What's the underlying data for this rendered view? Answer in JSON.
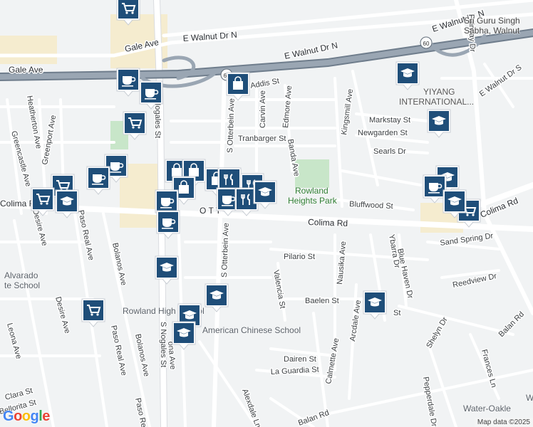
{
  "map": {
    "streets": {
      "e_walnut_dr_n_1": "E Walnut Dr N",
      "e_walnut_dr_n_2": "E Walnut Dr N",
      "e_walnut_dr_n_3": "E Walnut Dr N",
      "gale_ave_1": "Gale Ave",
      "gale_ave_2": "Gale Ave",
      "addis_st": "Addis St",
      "carvin_ave": "Carvin Ave",
      "edmore_ave": "Edmore Ave",
      "kingsmill_ave": "Kingsmill Ave",
      "markstay_st": "Markstay St",
      "newgarden_st": "Newgarden St",
      "searls_dr": "Searls Dr",
      "tranbarger_st": "Tranbarger St",
      "banda_ave": "Banda Ave",
      "s_otterbein_ave_1": "S Otterbein Ave",
      "s_otterbein_ave_2": "S Otterbein Ave",
      "s_nogales_st_1": "S Nogales St",
      "s_nogales_st_2": "S Nogales St",
      "colima_rd_1": "Colima Rd",
      "colima_rd_2": "Colima Rd",
      "colima_rd_left": "Colima R",
      "otterbein_partial": "O T T",
      "bluffwood_st": "Bluffwood St",
      "fairway_dr": "Fairway Dr",
      "e_walnut_dr_s": "E Walnut Dr S",
      "heatherton_ave": "Heatherton Ave",
      "greencastle_ave": "Greencastle Ave",
      "greenport_ave": "Greenport Ave",
      "desire_ave_1": "Desire Ave",
      "desire_ave_2": "Desire Ave",
      "paso_real_ave_1": "Paso Real Ave",
      "paso_real_ave_2": "Paso Real Ave",
      "paso_re": "Paso Re",
      "bolanos_ave_1": "Bolanos Ave",
      "bolanos_ave_2": "Bolanos Ave",
      "pilario_st": "Pilario St",
      "nausika_ave": "Nausika Ave",
      "ybarra_dr": "Ybarra Dr",
      "blue_haven_dr": "Blue Haven Dr",
      "sand_spring_dr": "Sand Spring Dr",
      "reedview_dr": "Reedview Dr",
      "valencia_st": "Valencia St",
      "baelen_st": "Baelen St",
      "arcdale_ave": "Arcdale Ave",
      "st_partial": "St",
      "shelyn_dr": "Shelyn Dr",
      "balan_rd_1": "Balan Rd",
      "balan_rd_2": "Balan Rd",
      "frances_ln": "Frances Ln",
      "dairen_st": "Dairen St",
      "la_guardia_st": "La Guardia St",
      "calmette_ave": "Calmette Ave",
      "pepperdale_dr": "Pepperdale Dr",
      "alexdale_ln": "Alexdale Ln",
      "leona_ave": "Leona Ave",
      "clara_st": "Clara St",
      "bellorita_st": "Bellorita St",
      "ona_ave": "ona Ave",
      "route_60_1": "60",
      "route_60_2": "60"
    },
    "places": {
      "sri_guru_line1": "Sri Guru Singh",
      "sri_guru_line2": "Sabha, Walnut",
      "yiyang": "YIYANG",
      "international": "INTERNATIONAL...",
      "park_line1": "Rowland",
      "park_line2": "Heights Park",
      "rowland_high": "Rowland High School",
      "american_chinese": "American Chinese School",
      "alvarado_line1": "Alvarado",
      "alvarado_line2": "te School",
      "water_oakle": "Water-Oakle",
      "w_partial": "W"
    },
    "markers": [
      {
        "kind": "shopping-cart"
      },
      {
        "kind": "shopping-bag"
      },
      {
        "kind": "school"
      },
      {
        "kind": "school"
      },
      {
        "kind": "cafe"
      },
      {
        "kind": "cafe"
      },
      {
        "kind": "shopping-cart"
      },
      {
        "kind": "cafe"
      },
      {
        "kind": "cafe"
      },
      {
        "kind": "shopping-cart"
      },
      {
        "kind": "shopping-cart"
      },
      {
        "kind": "school"
      },
      {
        "kind": "shopping-bag"
      },
      {
        "kind": "shopping-bag"
      },
      {
        "kind": "shopping-bag"
      },
      {
        "kind": "cafe"
      },
      {
        "kind": "cafe"
      },
      {
        "kind": "shopping-bag"
      },
      {
        "kind": "restaurant"
      },
      {
        "kind": "restaurant"
      },
      {
        "kind": "cafe"
      },
      {
        "kind": "restaurant"
      },
      {
        "kind": "school"
      },
      {
        "kind": "school"
      },
      {
        "kind": "cafe"
      },
      {
        "kind": "shopping-cart"
      },
      {
        "kind": "school"
      },
      {
        "kind": "school"
      },
      {
        "kind": "shopping-cart"
      },
      {
        "kind": "school"
      },
      {
        "kind": "school"
      },
      {
        "kind": "school"
      },
      {
        "kind": "school"
      }
    ],
    "colors": {
      "background": "#f1f3f4",
      "road": "#ffffff",
      "highway": "#8a97a6",
      "park": "#c8e6c9",
      "commercial": "#f5eccf",
      "marker": "#1f4e79"
    },
    "logo": "Google",
    "attribution": "Map data ©2025"
  }
}
